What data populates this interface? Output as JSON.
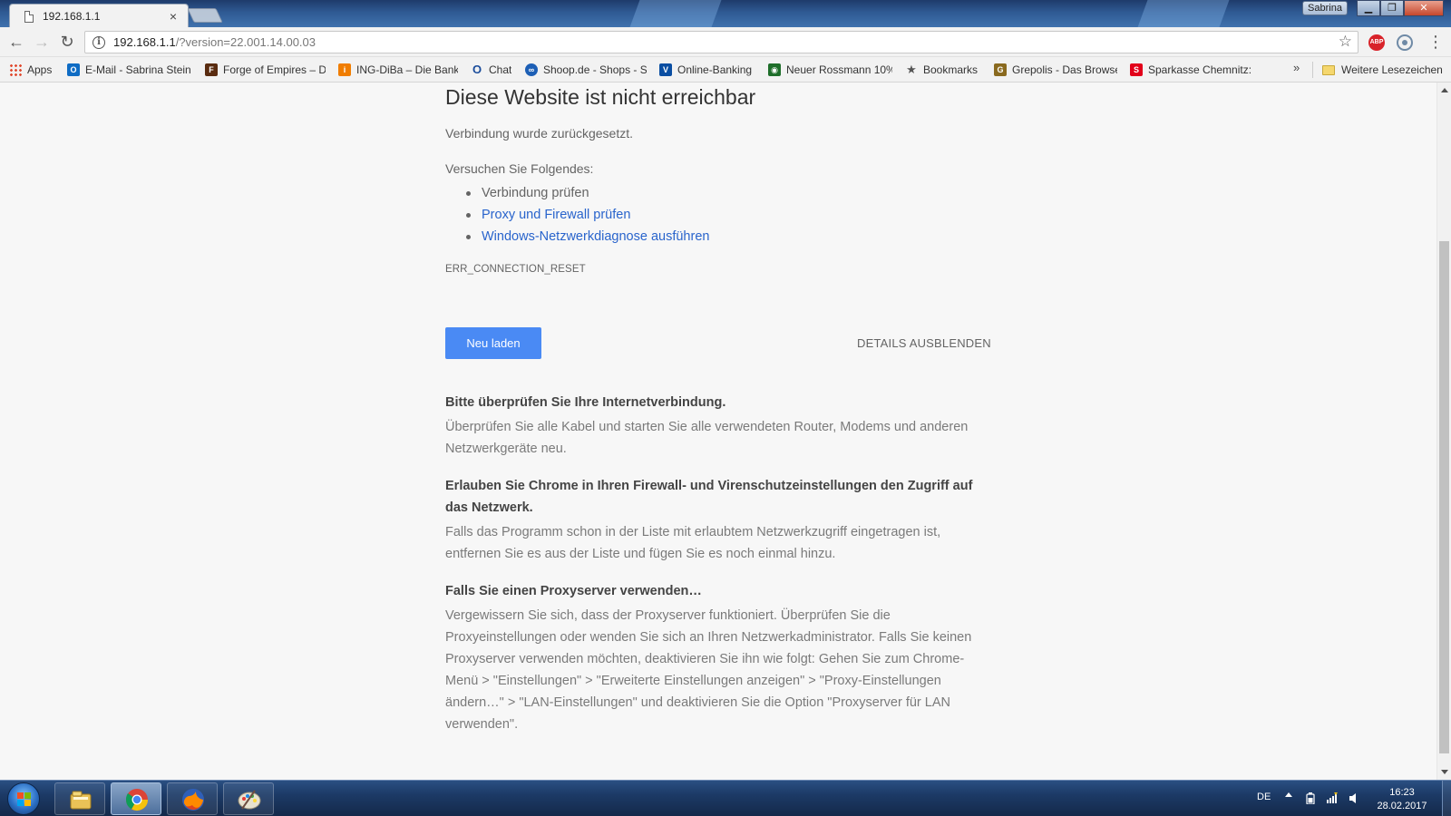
{
  "window": {
    "tab_title": "192.168.1.1",
    "tab_close": "×",
    "profile_name": "Sabrina",
    "win_minimize": "▁",
    "win_maximize": "❐",
    "win_close": "✕"
  },
  "toolbar": {
    "back": "←",
    "forward": "→",
    "reload": "↻",
    "url_host": "192.168.1.1",
    "url_rest": "/?version=22.001.14.00.03",
    "info_glyph": "i",
    "star": "☆",
    "abp_label": "ABP",
    "menu": "⋮"
  },
  "bookmarks": {
    "items": [
      {
        "label": "Apps",
        "icon": "apps-grid-icon",
        "color": "#e04a2f"
      },
      {
        "label": "E-Mail - Sabrina Stein",
        "icon": "outlook-icon",
        "color": "#0f6cc4"
      },
      {
        "label": "Forge of Empires – Da",
        "icon": "forge-icon",
        "color": "#5a2c10"
      },
      {
        "label": "ING-DiBa – Die Bank u",
        "icon": "ing-icon",
        "color": "#f07d00"
      },
      {
        "label": "Chat",
        "icon": "chat-icon",
        "color": "#1a4c9b"
      },
      {
        "label": "Shoop.de - Shops - Sh",
        "icon": "shoop-icon",
        "color": "#1d5fb5"
      },
      {
        "label": "Online-Banking",
        "icon": "bank-icon",
        "color": "#0a4ea2"
      },
      {
        "label": "Neuer Rossmann 10%",
        "icon": "rossmann-icon",
        "color": "#1e6e2a"
      },
      {
        "label": "Bookmarks",
        "icon": "star-icon",
        "color": "#555555"
      },
      {
        "label": "Grepolis - Das Browse",
        "icon": "grepolis-icon",
        "color": "#8a6a1f"
      },
      {
        "label": "Sparkasse Chemnitz: C",
        "icon": "sparkasse-icon",
        "color": "#e2001a"
      }
    ],
    "more": "»",
    "other_label": "Weitere Lesezeichen"
  },
  "error_page": {
    "title": "Diese Website ist nicht erreichbar",
    "subtitle": "Verbindung wurde zurückgesetzt.",
    "try_heading": "Versuchen Sie Folgendes:",
    "suggestions": [
      {
        "text": "Verbindung prüfen"
      },
      {
        "text": "Proxy und Firewall prüfen"
      },
      {
        "text": "Windows-Netzwerkdiagnose ausführen"
      }
    ],
    "error_code": "ERR_CONNECTION_RESET",
    "reload_button": "Neu laden",
    "details_button": "DETAILS AUSBLENDEN",
    "sections": [
      {
        "title": "Bitte überprüfen Sie Ihre Internetverbindung.",
        "body": "Überprüfen Sie alle Kabel und starten Sie alle verwendeten Router, Modems und anderen Netzwerkgeräte neu."
      },
      {
        "title": "Erlauben Sie Chrome in Ihren Firewall- und Virenschutzeinstellungen den Zugriff auf das Netzwerk.",
        "body": "Falls das Programm schon in der Liste mit erlaubtem Netzwerkzugriff eingetragen ist, entfernen Sie es aus der Liste und fügen Sie es noch einmal hinzu."
      },
      {
        "title": "Falls Sie einen Proxyserver verwenden…",
        "body": "Vergewissern Sie sich, dass der Proxyserver funktioniert. Überprüfen Sie die Proxyeinstellungen oder wenden Sie sich an Ihren Netzwerkadministrator. Falls Sie keinen Proxyserver verwenden möchten, deaktivieren Sie ihn wie folgt: Gehen Sie zum Chrome-Menü > \"Einstellungen\" > \"Erweiterte Einstellungen anzeigen\" > \"Proxy-Einstellungen ändern…\" > \"LAN-Einstellungen\" und deaktivieren Sie die Option \"Proxyserver für LAN verwenden\"."
      }
    ]
  },
  "taskbar": {
    "language": "DE",
    "time": "16:23",
    "date": "28.02.2017",
    "apps": [
      "explorer-icon",
      "chrome-icon",
      "firefox-icon",
      "paint-icon"
    ]
  }
}
